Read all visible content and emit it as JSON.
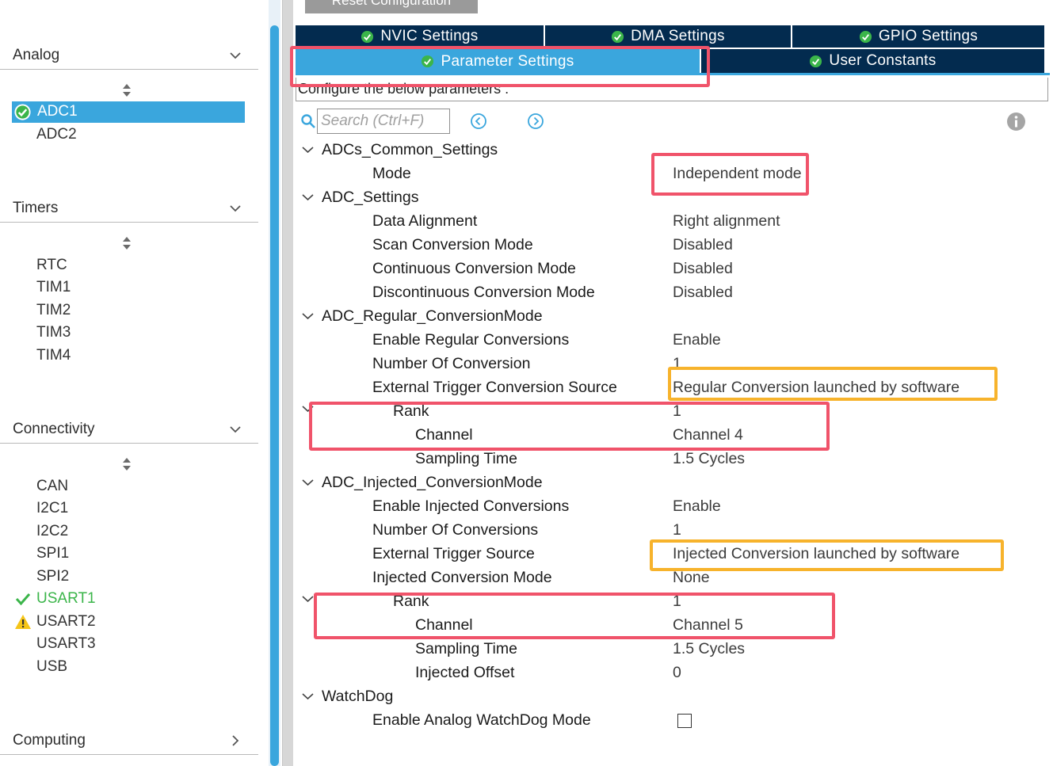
{
  "sidebar": {
    "categories": {
      "analog": {
        "title": "Analog",
        "items": [
          "ADC1",
          "ADC2"
        ]
      },
      "timers": {
        "title": "Timers",
        "items": [
          "RTC",
          "TIM1",
          "TIM2",
          "TIM3",
          "TIM4"
        ]
      },
      "connectivity": {
        "title": "Connectivity",
        "items": [
          "CAN",
          "I2C1",
          "I2C2",
          "SPI1",
          "SPI2",
          "USART1",
          "USART2",
          "USART3",
          "USB"
        ]
      },
      "computing": {
        "title": "Computing"
      }
    },
    "selected_item": "ADC1",
    "status": {
      "ADC1": "check-ok",
      "USART1": "check-green",
      "USART2": "warning"
    }
  },
  "toolbar": {
    "reset_label": "Reset Configuration"
  },
  "tabs": [
    {
      "label": "NVIC Settings"
    },
    {
      "label": "DMA Settings"
    },
    {
      "label": "GPIO Settings"
    },
    {
      "label": "Parameter Settings",
      "active": true
    },
    {
      "label": "User Constants"
    }
  ],
  "config_label": "Configure the below parameters :",
  "search": {
    "placeholder": "Search (Ctrl+F)"
  },
  "tree": {
    "common": {
      "title": "ADCs_Common_Settings",
      "mode": {
        "name": "Mode",
        "value": "Independent mode"
      }
    },
    "adc": {
      "title": "ADC_Settings",
      "rows": [
        {
          "name": "Data Alignment",
          "value": "Right alignment"
        },
        {
          "name": "Scan Conversion Mode",
          "value": "Disabled"
        },
        {
          "name": "Continuous Conversion Mode",
          "value": "Disabled"
        },
        {
          "name": "Discontinuous Conversion Mode",
          "value": "Disabled"
        }
      ]
    },
    "regular": {
      "title": "ADC_Regular_ConversionMode",
      "rows": [
        {
          "name": "Enable Regular Conversions",
          "value": "Enable"
        },
        {
          "name": "Number Of Conversion",
          "value": "1"
        },
        {
          "name": "External Trigger Conversion Source",
          "value": "Regular Conversion launched by software"
        }
      ],
      "rank": {
        "name": "Rank",
        "value": "1"
      },
      "channel": {
        "name": "Channel",
        "value": "Channel 4"
      },
      "sampling": {
        "name": "Sampling Time",
        "value": "1.5 Cycles"
      }
    },
    "injected": {
      "title": "ADC_Injected_ConversionMode",
      "rows": [
        {
          "name": "Enable Injected Conversions",
          "value": "Enable"
        },
        {
          "name": "Number Of Conversions",
          "value": "1"
        },
        {
          "name": "External Trigger Source",
          "value": "Injected Conversion launched by software"
        },
        {
          "name": "Injected Conversion Mode",
          "value": "None"
        }
      ],
      "rank": {
        "name": "Rank",
        "value": "1"
      },
      "channel": {
        "name": "Channel",
        "value": "Channel 5"
      },
      "sampling": {
        "name": "Sampling Time",
        "value": "1.5 Cycles"
      },
      "offset": {
        "name": "Injected Offset",
        "value": "0"
      }
    },
    "watchdog": {
      "title": "WatchDog",
      "enable": {
        "name": "Enable Analog WatchDog Mode",
        "checked": false
      }
    }
  },
  "colors": {
    "accent": "#3aa6dd",
    "tab_dark": "#032b4f",
    "highlight_red": "#f0536a",
    "highlight_orange": "#f7b32c",
    "ok_green": "#3bb54a",
    "warning_yellow": "#f5c518"
  }
}
